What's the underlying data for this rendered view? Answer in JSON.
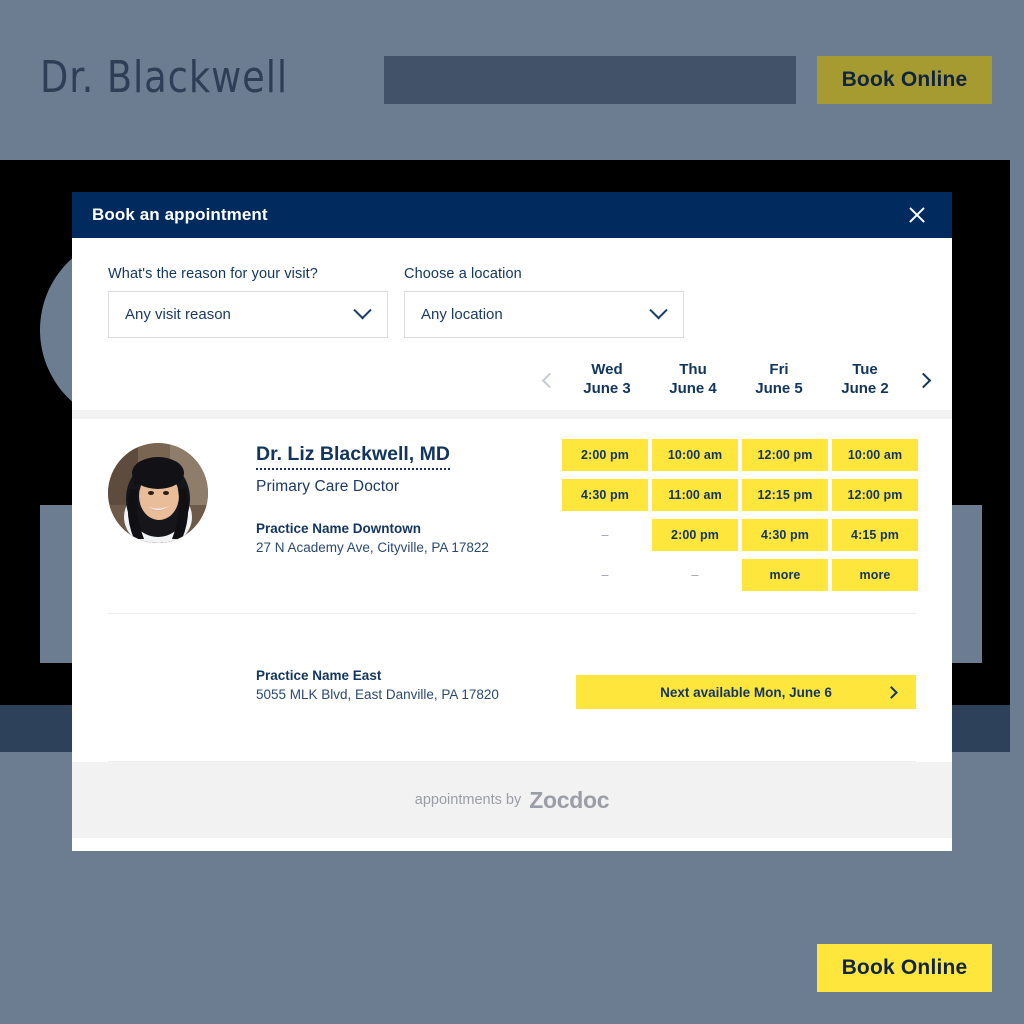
{
  "site": {
    "logo_text": "Dr. Blackwell",
    "search_placeholder": "",
    "book_online_top_label": "Book Online",
    "book_online_bottom_label": "Book Online",
    "accent_yellow": "#ffe63c",
    "accent_yellow_dimmed": "#a69b30",
    "navy": "#012a5e",
    "page_bg": "#6d7d91"
  },
  "modal": {
    "title": "Book an appointment",
    "close_label": "×",
    "filters": [
      {
        "label": "What's the reason for your visit?",
        "value": "Any visit reason",
        "icon": "chevron-down-icon"
      },
      {
        "label": "Choose a location",
        "value": "Any location",
        "icon": "chevron-down-icon"
      }
    ],
    "date_nav": {
      "prev_icon": "chevron-left-icon",
      "next_icon": "chevron-right-icon",
      "prev_enabled": false,
      "next_enabled": true,
      "dates": [
        {
          "dow": "Wed",
          "day": "June 3"
        },
        {
          "dow": "Thu",
          "day": "June 4"
        },
        {
          "dow": "Fri",
          "day": "June 5"
        },
        {
          "dow": "Tue",
          "day": "June 2"
        }
      ]
    },
    "provider": {
      "name": "Dr. Liz Blackwell, MD",
      "specialty": "Primary Care Doctor",
      "practice_name": "Practice Name Downtown",
      "practice_address": "27 N Academy Ave, Cityville, PA 17822",
      "avatar_alt": "doctor-headshot"
    },
    "slots": [
      "2:00 pm",
      "10:00 am",
      "12:00 pm",
      "10:00 am",
      "4:30 pm",
      "11:00 am",
      "12:15 pm",
      "12:00 pm",
      "–",
      "2:00 pm",
      "4:30 pm",
      "4:15 pm",
      "–",
      "–",
      "more",
      "more"
    ],
    "slot_empty_token": "–",
    "second_practice": {
      "practice_name": "Practice Name East",
      "practice_address": "5055 MLK Blvd, East Danville, PA 17820",
      "next_available_label": "Next available Mon, June 6",
      "next_icon": "chevron-right-icon"
    },
    "footer": {
      "by_text": "appointments by",
      "brand": "Zocdoc"
    }
  }
}
